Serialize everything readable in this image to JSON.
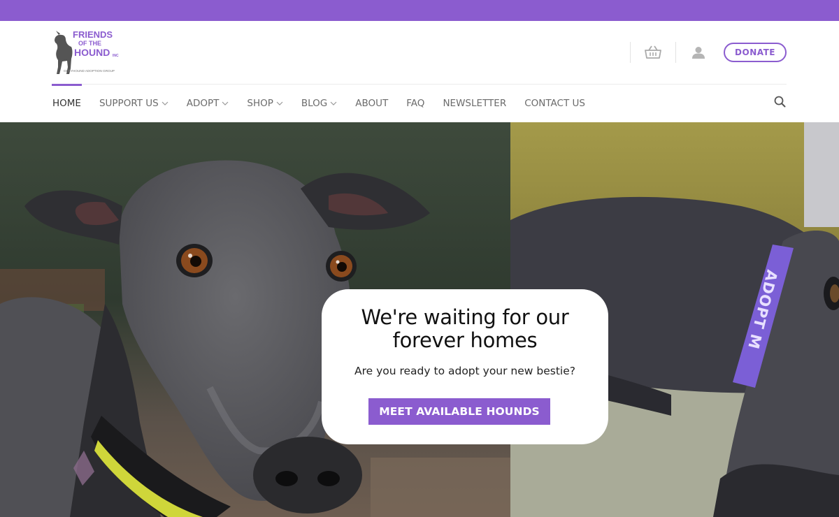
{
  "brand": {
    "logo_lines": [
      "FRIENDS",
      "OF THE",
      "HOUND",
      "INC"
    ],
    "logo_tagline": "GREYHOUND ADOPTION GROUP",
    "accent_color": "#8b5ccf"
  },
  "header": {
    "cart_icon": "basket-icon",
    "account_icon": "user-icon",
    "donate_label": "DONATE"
  },
  "nav": {
    "items": [
      {
        "label": "HOME",
        "active": true,
        "has_dropdown": false
      },
      {
        "label": "SUPPORT US",
        "active": false,
        "has_dropdown": true
      },
      {
        "label": "ADOPT",
        "active": false,
        "has_dropdown": true
      },
      {
        "label": "SHOP",
        "active": false,
        "has_dropdown": true
      },
      {
        "label": "BLOG",
        "active": false,
        "has_dropdown": true
      },
      {
        "label": "ABOUT",
        "active": false,
        "has_dropdown": false
      },
      {
        "label": "FAQ",
        "active": false,
        "has_dropdown": false
      },
      {
        "label": "NEWSLETTER",
        "active": false,
        "has_dropdown": false
      },
      {
        "label": "CONTACT US",
        "active": false,
        "has_dropdown": false
      }
    ],
    "search_icon": "search-icon"
  },
  "hero": {
    "collar_text": "ADOPT M",
    "title_line1": "We're waiting for our",
    "title_line2": "forever homes",
    "subtitle": "Are you ready to adopt your new bestie?",
    "cta_label": "MEET AVAILABLE HOUNDS"
  }
}
